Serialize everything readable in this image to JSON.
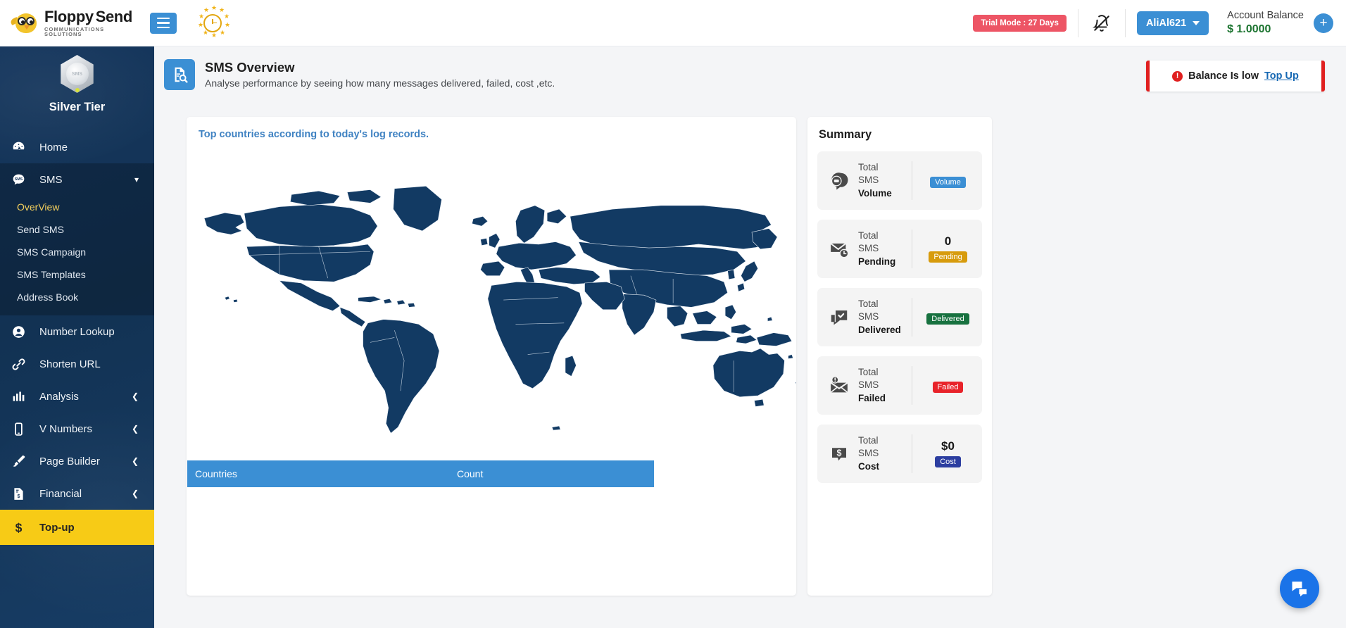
{
  "brand": {
    "name_part1": "Floppy",
    "name_part2": "Send",
    "tagline": "COMMUNICATIONS  SOLUTIONS",
    "logo_icon": "owl-logo-icon"
  },
  "topbar": {
    "menu_toggle_icon": "hamburger-menu-icon",
    "eu_clock_icon": "eu-stars-clock-icon",
    "trial_badge": "Trial Mode : 27 Days",
    "notifications_icon": "bell-slash-icon",
    "user_name": "AliAl621",
    "balance_label": "Account Balance",
    "balance_value": "$ 1.0000",
    "add_balance_icon": "plus-icon",
    "accent_blue": "#3b8fd4",
    "trial_red": "#ed5565",
    "balance_green": "#1c7430"
  },
  "sidebar": {
    "tier_name": "Silver Tier",
    "tier_badge_icon": "silver-hexagon-badge-icon",
    "items": [
      {
        "label": "Home",
        "icon": "dashboard-gauge-icon",
        "has_chevron": false,
        "active": false
      },
      {
        "label": "SMS",
        "icon": "sms-bubble-icon",
        "has_chevron": true,
        "chevron": "down",
        "expanded": true
      },
      {
        "label": "Number Lookup",
        "icon": "user-circle-icon",
        "has_chevron": false
      },
      {
        "label": "Shorten URL",
        "icon": "link-chain-icon",
        "has_chevron": false
      },
      {
        "label": "Analysis",
        "icon": "bar-chart-icon",
        "has_chevron": true,
        "chevron": "left"
      },
      {
        "label": "V Numbers",
        "icon": "mobile-phone-icon",
        "has_chevron": true,
        "chevron": "left"
      },
      {
        "label": "Page Builder",
        "icon": "paint-brush-icon",
        "has_chevron": true,
        "chevron": "left"
      },
      {
        "label": "Financial",
        "icon": "invoice-dollar-icon",
        "has_chevron": true,
        "chevron": "left"
      },
      {
        "label": "Top-up",
        "icon": "dollar-sign-icon",
        "has_chevron": false,
        "highlighted": true
      }
    ],
    "sms_submenu": [
      {
        "label": "OverView",
        "active": true
      },
      {
        "label": "Send SMS",
        "active": false
      },
      {
        "label": "SMS Campaign",
        "active": false
      },
      {
        "label": "SMS Templates",
        "active": false
      },
      {
        "label": "Address Book",
        "active": false
      }
    ],
    "topup_bg": "#f7cb16",
    "active_submenu_color": "#f3cf5d"
  },
  "page": {
    "icon": "document-search-icon",
    "title": "SMS Overview",
    "description": "Analyse performance by seeing how many messages delivered, failed, cost ,etc.",
    "low_balance": {
      "alert_icon": "exclamation-circle-icon",
      "text": "Balance Is low",
      "link": "Top Up",
      "border_color": "#e02020"
    }
  },
  "map_card": {
    "title": "Top countries according to today's log records.",
    "map_icon": "world-map",
    "map_fill": "#123a63",
    "table": {
      "columns": [
        "Countries",
        "Count"
      ],
      "rows": [],
      "header_bg": "#3b8fd4"
    }
  },
  "summary": {
    "title": "Summary",
    "stats": [
      {
        "icon": "sms-volume-icon",
        "line1": "Total",
        "line2": "SMS",
        "line3": "Volume",
        "value": "",
        "badge": "Volume",
        "badge_class": "b-volume"
      },
      {
        "icon": "mail-clock-icon",
        "line1": "Total",
        "line2": "SMS",
        "line3": "Pending",
        "value": "0",
        "badge": "Pending",
        "badge_class": "b-pending"
      },
      {
        "icon": "chat-check-icon",
        "line1": "Total",
        "line2": "SMS",
        "line3": "Delivered",
        "value": "",
        "badge": "Delivered",
        "badge_class": "b-delivered"
      },
      {
        "icon": "mail-alert-icon",
        "line1": "Total",
        "line2": "SMS",
        "line3": "Failed",
        "value": "",
        "badge": "Failed",
        "badge_class": "b-failed"
      },
      {
        "icon": "dollar-bubble-icon",
        "line1": "Total",
        "line2": "SMS",
        "line3": "Cost",
        "value": "$0",
        "badge": "Cost",
        "badge_class": "b-cost"
      }
    ]
  },
  "chat_fab": {
    "icon": "chat-bubbles-icon",
    "color": "#1a73e8"
  }
}
